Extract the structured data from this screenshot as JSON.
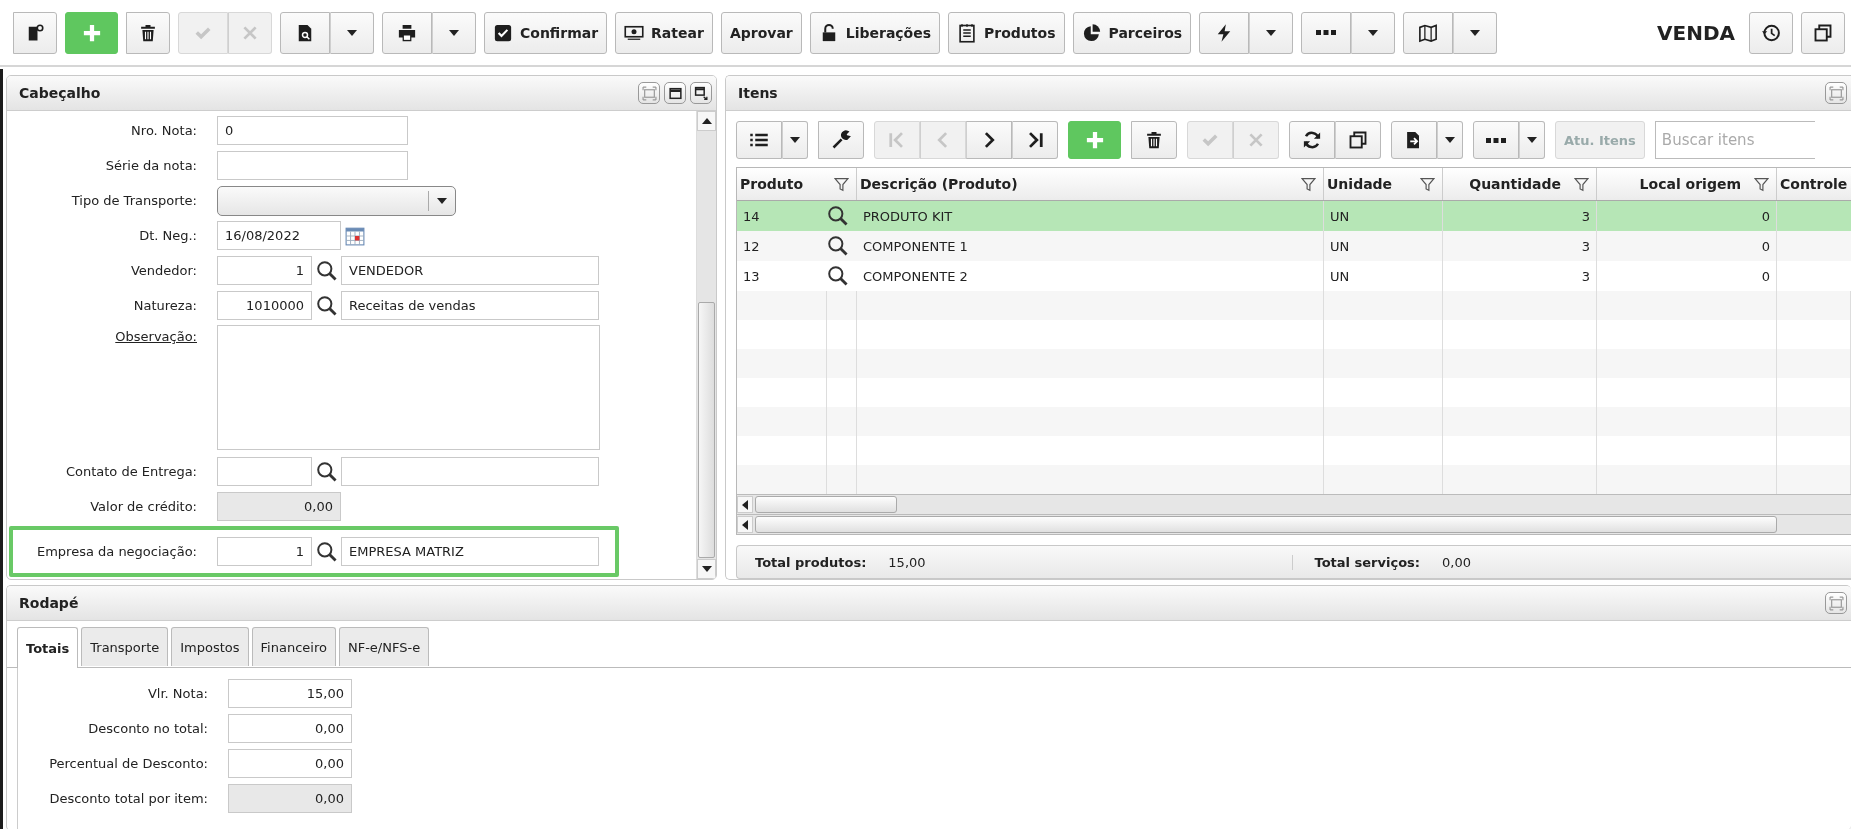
{
  "toolbar": {
    "groups": [
      {
        "kind": "group",
        "buttons": [
          {
            "disabled": false
          }
        ]
      },
      {
        "kind": "add"
      },
      {
        "kind": "group",
        "buttons": [
          {
            "disabled": false
          }
        ]
      },
      {
        "kind": "group",
        "buttons": [
          {
            "disabled": true
          },
          {
            "disabled": true
          }
        ]
      },
      {
        "kind": "split",
        "disabled": false
      },
      {
        "kind": "split",
        "disabled": false
      },
      {
        "kind": "text",
        "label": "Confirmar",
        "disabled": false
      },
      {
        "kind": "text",
        "label": "Ratear",
        "disabled": false
      },
      {
        "kind": "text",
        "label": "Aprovar",
        "disabled": false
      },
      {
        "kind": "text",
        "label": "Liberações",
        "disabled": false
      },
      {
        "kind": "text",
        "label": "Produtos",
        "disabled": false
      },
      {
        "kind": "text",
        "label": "Parceiros",
        "disabled": false
      },
      {
        "kind": "split",
        "disabled": false
      },
      {
        "kind": "split",
        "disabled": false
      },
      {
        "kind": "split",
        "disabled": false
      }
    ],
    "title": "VENDA"
  },
  "cabecalho": {
    "title": "Cabeçalho",
    "rows": [
      {
        "kind": "text",
        "label": "Nro. Nota:",
        "value": "0",
        "highlighted": false
      },
      {
        "kind": "text",
        "label": "Série da nota:",
        "highlighted": false
      },
      {
        "kind": "select",
        "label": "Tipo de Transporte:",
        "highlighted": false
      },
      {
        "kind": "date",
        "label": "Dt. Neg.:",
        "value": "16/08/2022",
        "highlighted": false
      },
      {
        "kind": "lookup",
        "label": "Vendedor:",
        "code": "1",
        "description": "VENDEDOR",
        "highlighted": false
      },
      {
        "kind": "lookup",
        "label": "Natureza:",
        "code": "1010000",
        "description": "Receitas de vendas",
        "highlighted": false
      },
      {
        "kind": "textarea",
        "label": "Observação:",
        "highlighted": false
      },
      {
        "kind": "lookup",
        "label": "Contato de Entrega:",
        "highlighted": false
      },
      {
        "kind": "readonly",
        "label": "Valor de crédito:",
        "value": "0,00",
        "highlighted": false
      },
      {
        "kind": "lookup",
        "label": "Empresa da negociação:",
        "code": "1",
        "description": "EMPRESA MATRIZ",
        "highlighted": true
      }
    ]
  },
  "itens": {
    "title": "Itens",
    "toolbar": {
      "groups": [
        {
          "kind": "split",
          "disabled": false
        },
        {
          "kind": "group",
          "buttons": [
            {
              "disabled": false
            }
          ]
        },
        {
          "kind": "group",
          "buttons": [
            {
              "disabled": true
            },
            {
              "disabled": true
            },
            {
              "disabled": false
            },
            {
              "disabled": false
            }
          ]
        },
        {
          "kind": "add"
        },
        {
          "kind": "group",
          "buttons": [
            {
              "disabled": false
            }
          ]
        },
        {
          "kind": "group",
          "buttons": [
            {
              "disabled": true
            },
            {
              "disabled": true
            }
          ]
        },
        {
          "kind": "group",
          "buttons": [
            {
              "disabled": false
            },
            {
              "disabled": false
            }
          ]
        },
        {
          "kind": "split",
          "disabled": false
        },
        {
          "kind": "split",
          "disabled": false
        },
        {
          "kind": "text",
          "label": "Atu. Itens",
          "disabled": true
        }
      ],
      "search": {
        "placeholder": "Buscar itens"
      }
    },
    "grid": {
      "columns": [
        {
          "label": "Produto"
        },
        {
          "label": "Descrição (Produto)"
        },
        {
          "label": "Unidade"
        },
        {
          "label": "Quantidade"
        },
        {
          "label": "Local origem"
        },
        {
          "label": "Controle"
        }
      ],
      "rows": [
        {
          "selected": true,
          "cells": [
            "14",
            "PRODUTO KIT",
            "UN",
            "3",
            "0"
          ]
        },
        {
          "selected": false,
          "cells": [
            "12",
            "COMPONENTE 1",
            "UN",
            "3",
            "0"
          ]
        },
        {
          "selected": false,
          "cells": [
            "13",
            "COMPONENTE 2",
            "UN",
            "3",
            "0"
          ]
        }
      ]
    },
    "totals": [
      {
        "label": "Total produtos:",
        "value": "15,00"
      },
      {
        "label": "Total serviços:",
        "value": "0,00"
      }
    ]
  },
  "rodape": {
    "title": "Rodapé",
    "tabs": [
      {
        "label": "Totais",
        "selected": true
      },
      {
        "label": "Transporte",
        "selected": false
      },
      {
        "label": "Impostos",
        "selected": false
      },
      {
        "label": "Financeiro",
        "selected": false
      },
      {
        "label": "NF-e/NFS-e",
        "selected": false
      }
    ],
    "fields": [
      {
        "kind": "number",
        "label": "Vlr. Nota:",
        "value": "15,00"
      },
      {
        "kind": "number",
        "label": "Desconto no total:",
        "value": "0,00"
      },
      {
        "kind": "number",
        "label": "Percentual de Desconto:",
        "value": "0,00"
      },
      {
        "kind": "readonly",
        "label": "Desconto total por item:",
        "value": "0,00"
      }
    ]
  }
}
